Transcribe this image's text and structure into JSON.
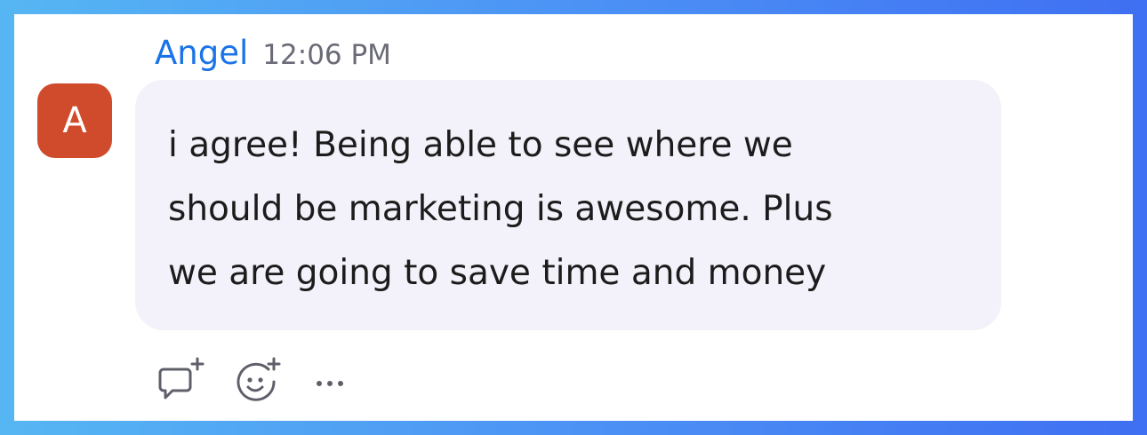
{
  "message": {
    "sender": "Angel",
    "time": "12:06 PM",
    "avatar_initial": "A",
    "text": "i agree! Being able to see where we\nshould be marketing is awesome. Plus\nwe are going to save time and money"
  },
  "actions": {
    "icons": [
      "reply-add-icon",
      "reaction-add-icon",
      "more-options-icon"
    ]
  },
  "colors": {
    "sender": "#1a73e8",
    "avatar": "#d04a2c",
    "bubble": "#f3f1f9",
    "icon": "#5f5f6b"
  }
}
